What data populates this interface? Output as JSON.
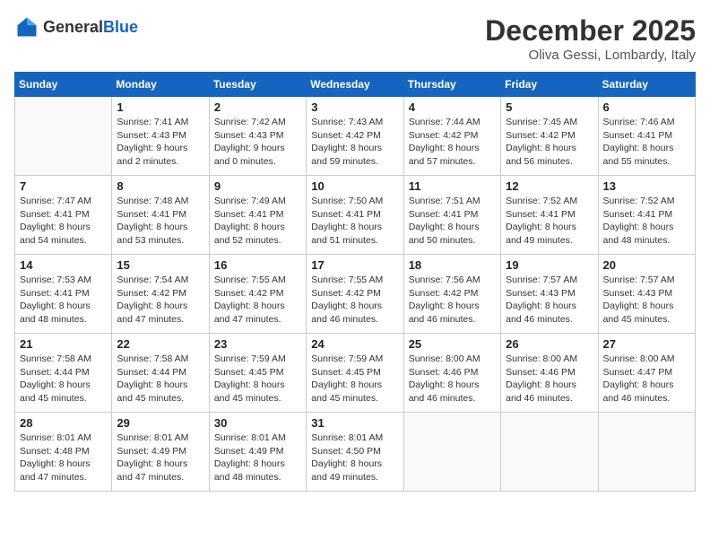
{
  "logo": {
    "general": "General",
    "blue": "Blue"
  },
  "header": {
    "month": "December 2025",
    "location": "Oliva Gessi, Lombardy, Italy"
  },
  "days_of_week": [
    "Sunday",
    "Monday",
    "Tuesday",
    "Wednesday",
    "Thursday",
    "Friday",
    "Saturday"
  ],
  "weeks": [
    [
      {
        "day": "",
        "info": ""
      },
      {
        "day": "1",
        "info": "Sunrise: 7:41 AM\nSunset: 4:43 PM\nDaylight: 9 hours\nand 2 minutes."
      },
      {
        "day": "2",
        "info": "Sunrise: 7:42 AM\nSunset: 4:43 PM\nDaylight: 9 hours\nand 0 minutes."
      },
      {
        "day": "3",
        "info": "Sunrise: 7:43 AM\nSunset: 4:42 PM\nDaylight: 8 hours\nand 59 minutes."
      },
      {
        "day": "4",
        "info": "Sunrise: 7:44 AM\nSunset: 4:42 PM\nDaylight: 8 hours\nand 57 minutes."
      },
      {
        "day": "5",
        "info": "Sunrise: 7:45 AM\nSunset: 4:42 PM\nDaylight: 8 hours\nand 56 minutes."
      },
      {
        "day": "6",
        "info": "Sunrise: 7:46 AM\nSunset: 4:41 PM\nDaylight: 8 hours\nand 55 minutes."
      }
    ],
    [
      {
        "day": "7",
        "info": "Sunrise: 7:47 AM\nSunset: 4:41 PM\nDaylight: 8 hours\nand 54 minutes."
      },
      {
        "day": "8",
        "info": "Sunrise: 7:48 AM\nSunset: 4:41 PM\nDaylight: 8 hours\nand 53 minutes."
      },
      {
        "day": "9",
        "info": "Sunrise: 7:49 AM\nSunset: 4:41 PM\nDaylight: 8 hours\nand 52 minutes."
      },
      {
        "day": "10",
        "info": "Sunrise: 7:50 AM\nSunset: 4:41 PM\nDaylight: 8 hours\nand 51 minutes."
      },
      {
        "day": "11",
        "info": "Sunrise: 7:51 AM\nSunset: 4:41 PM\nDaylight: 8 hours\nand 50 minutes."
      },
      {
        "day": "12",
        "info": "Sunrise: 7:52 AM\nSunset: 4:41 PM\nDaylight: 8 hours\nand 49 minutes."
      },
      {
        "day": "13",
        "info": "Sunrise: 7:52 AM\nSunset: 4:41 PM\nDaylight: 8 hours\nand 48 minutes."
      }
    ],
    [
      {
        "day": "14",
        "info": "Sunrise: 7:53 AM\nSunset: 4:41 PM\nDaylight: 8 hours\nand 48 minutes."
      },
      {
        "day": "15",
        "info": "Sunrise: 7:54 AM\nSunset: 4:42 PM\nDaylight: 8 hours\nand 47 minutes."
      },
      {
        "day": "16",
        "info": "Sunrise: 7:55 AM\nSunset: 4:42 PM\nDaylight: 8 hours\nand 47 minutes."
      },
      {
        "day": "17",
        "info": "Sunrise: 7:55 AM\nSunset: 4:42 PM\nDaylight: 8 hours\nand 46 minutes."
      },
      {
        "day": "18",
        "info": "Sunrise: 7:56 AM\nSunset: 4:42 PM\nDaylight: 8 hours\nand 46 minutes."
      },
      {
        "day": "19",
        "info": "Sunrise: 7:57 AM\nSunset: 4:43 PM\nDaylight: 8 hours\nand 46 minutes."
      },
      {
        "day": "20",
        "info": "Sunrise: 7:57 AM\nSunset: 4:43 PM\nDaylight: 8 hours\nand 45 minutes."
      }
    ],
    [
      {
        "day": "21",
        "info": "Sunrise: 7:58 AM\nSunset: 4:44 PM\nDaylight: 8 hours\nand 45 minutes."
      },
      {
        "day": "22",
        "info": "Sunrise: 7:58 AM\nSunset: 4:44 PM\nDaylight: 8 hours\nand 45 minutes."
      },
      {
        "day": "23",
        "info": "Sunrise: 7:59 AM\nSunset: 4:45 PM\nDaylight: 8 hours\nand 45 minutes."
      },
      {
        "day": "24",
        "info": "Sunrise: 7:59 AM\nSunset: 4:45 PM\nDaylight: 8 hours\nand 45 minutes."
      },
      {
        "day": "25",
        "info": "Sunrise: 8:00 AM\nSunset: 4:46 PM\nDaylight: 8 hours\nand 46 minutes."
      },
      {
        "day": "26",
        "info": "Sunrise: 8:00 AM\nSunset: 4:46 PM\nDaylight: 8 hours\nand 46 minutes."
      },
      {
        "day": "27",
        "info": "Sunrise: 8:00 AM\nSunset: 4:47 PM\nDaylight: 8 hours\nand 46 minutes."
      }
    ],
    [
      {
        "day": "28",
        "info": "Sunrise: 8:01 AM\nSunset: 4:48 PM\nDaylight: 8 hours\nand 47 minutes."
      },
      {
        "day": "29",
        "info": "Sunrise: 8:01 AM\nSunset: 4:49 PM\nDaylight: 8 hours\nand 47 minutes."
      },
      {
        "day": "30",
        "info": "Sunrise: 8:01 AM\nSunset: 4:49 PM\nDaylight: 8 hours\nand 48 minutes."
      },
      {
        "day": "31",
        "info": "Sunrise: 8:01 AM\nSunset: 4:50 PM\nDaylight: 8 hours\nand 49 minutes."
      },
      {
        "day": "",
        "info": ""
      },
      {
        "day": "",
        "info": ""
      },
      {
        "day": "",
        "info": ""
      }
    ]
  ]
}
